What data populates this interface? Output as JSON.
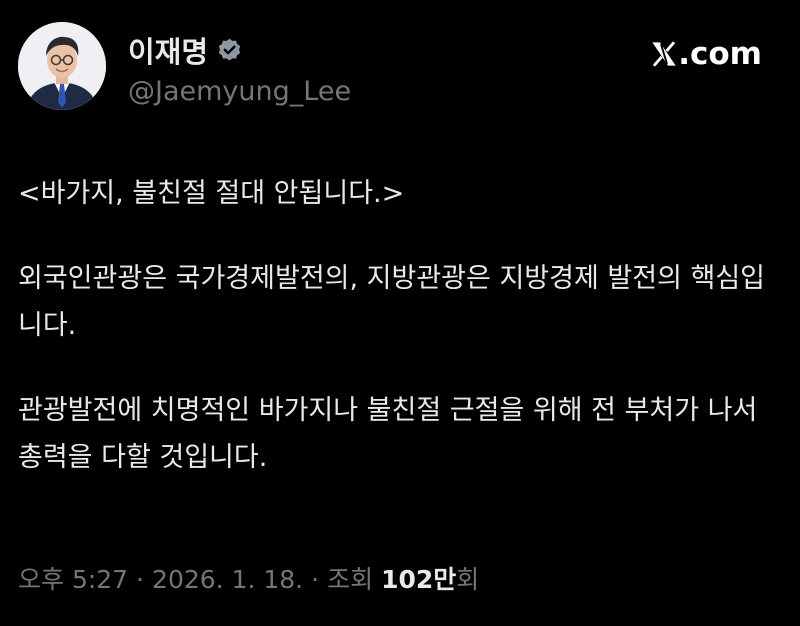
{
  "author": {
    "display_name": "이재명",
    "handle": "@Jaemyung_Lee",
    "verified": true,
    "verified_badge_color": "#8b98a5",
    "avatar_icon": "portrait-avatar"
  },
  "brand": {
    "logo_icon": "x-logo-icon",
    "text": ".com"
  },
  "tweet": {
    "paragraphs": [
      "<바가지, 불친절 절대 안됩니다.>",
      "외국인관광은 국가경제발전의, 지방관광은 지방경제 발전의 핵심입니다.",
      "관광발전에 치명적인 바가지나 불친절 근절을 위해 전 부처가 나서 총력을 다할 것입니다."
    ]
  },
  "meta": {
    "time": "오후 5:27",
    "separator": "·",
    "date": "2026. 1. 18.",
    "views_label": "조회",
    "views_count": "102만",
    "views_unit": "회"
  },
  "colors": {
    "background": "#000000",
    "text_primary": "#e7e9ea",
    "text_secondary": "#71767b"
  }
}
